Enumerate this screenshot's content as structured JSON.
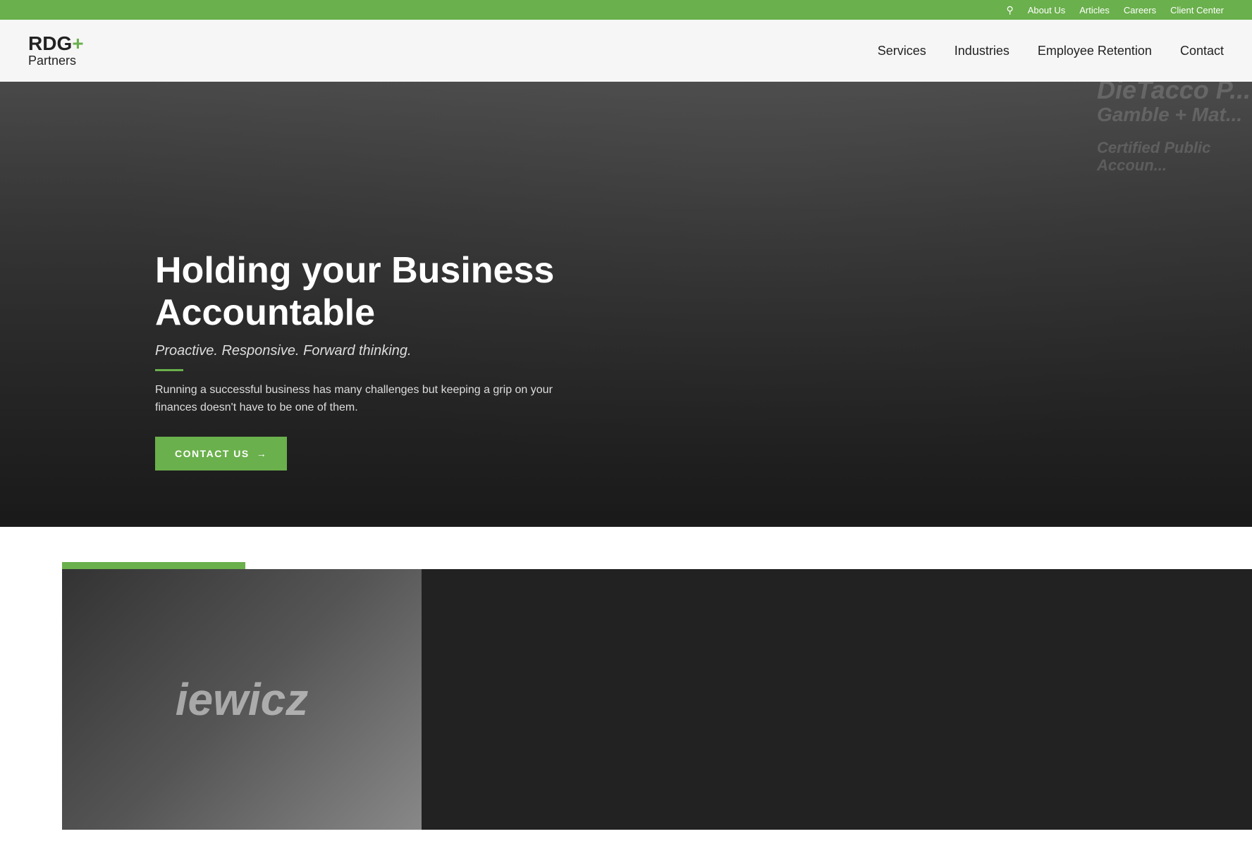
{
  "topbar": {
    "links": [
      "About Us",
      "Articles",
      "Careers",
      "Client Center"
    ],
    "search_label": "Search"
  },
  "navbar": {
    "logo": {
      "main": "RDG",
      "plus": "+",
      "sub": "Partners"
    },
    "nav_items": [
      {
        "label": "Services",
        "id": "services"
      },
      {
        "label": "Industries",
        "id": "industries"
      },
      {
        "label": "Employee Retention",
        "id": "employee-retention"
      },
      {
        "label": "Contact",
        "id": "contact"
      }
    ]
  },
  "hero": {
    "title": "Holding your Business Accountable",
    "subtitle": "Proactive. Responsive. Forward thinking.",
    "description": "Running a successful business has many challenges but keeping a grip on your finances doesn't have to be one of them.",
    "cta_label": "CONTACT US",
    "cta_arrow": "→"
  },
  "below": {
    "photo_text": "iewicz",
    "green_bar_present": true
  }
}
